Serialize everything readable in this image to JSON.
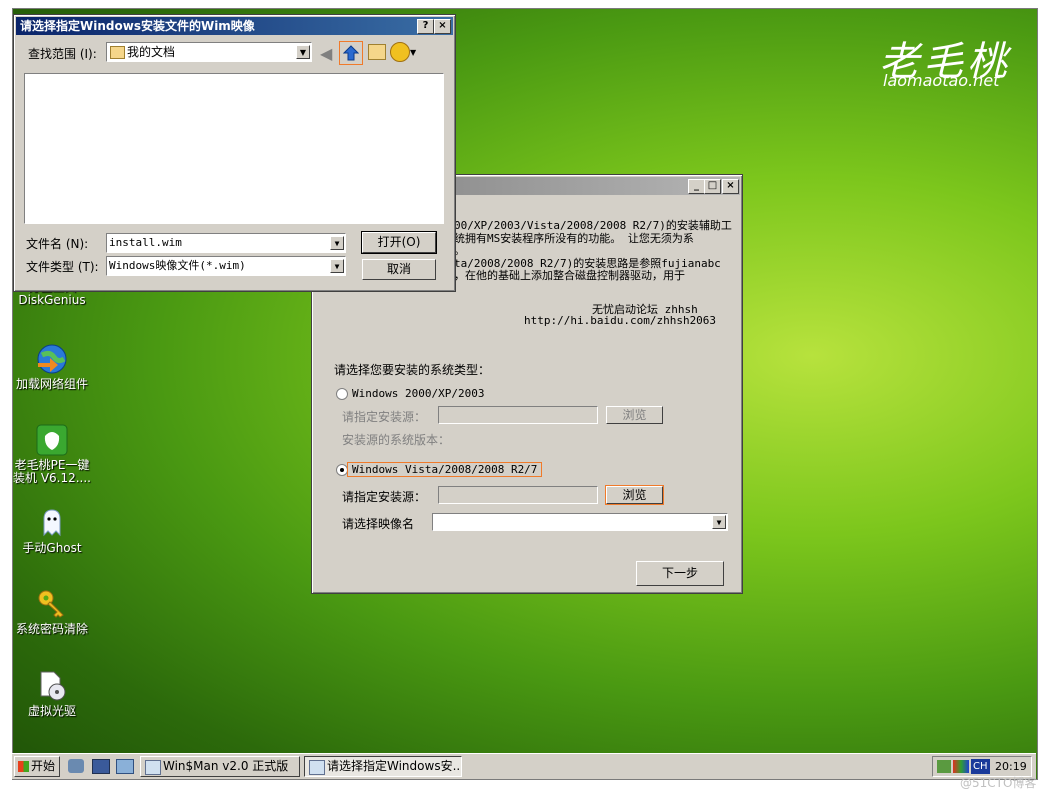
{
  "brand": {
    "logo": "老毛桃",
    "url": "laomaotao.net"
  },
  "desktop_icons": [
    {
      "label": "分区工具\nDiskGenius",
      "icon": "disk-icon"
    },
    {
      "label": "加载网络组件",
      "icon": "globe-icon"
    },
    {
      "label": "老毛桃PE一键装机 V6.12....",
      "icon": "installer-icon"
    },
    {
      "label": "手动Ghost",
      "icon": "ghost-icon"
    },
    {
      "label": "系统密码清除",
      "icon": "key-icon"
    },
    {
      "label": "虚拟光驱",
      "icon": "cdrom-icon"
    }
  ],
  "file_dialog": {
    "title": "请选择指定Windows安装文件的Wim映像",
    "help": "?",
    "close": "×",
    "look_in_label": "查找范围 (I):",
    "look_in_value": "我的文档",
    "filename_label": "文件名 (N):",
    "filename_value": "install.wim",
    "filetype_label": "文件类型 (T):",
    "filetype_value": "Windows映像文件(*.wim)",
    "open_button": "打开(O)",
    "cancel_button": "取消"
  },
  "main_window": {
    "minimize": "_",
    "maximize": "□",
    "close": "×",
    "desc_line1": "00/XP/2003/Vista/2008/2008 R2/7)的安装辅助工",
    "desc_line2": "统拥有MS安装程序所没有的功能。 让您无须为系",
    "desc_line3": "。",
    "desc_line4": "ta/2008/2008 R2/7)的安装思路是参照fujianabc",
    "desc_line5": "，在他的基础上添加整合磁盘控制器驱动，用于",
    "author": "无忧启动论坛 zhhsh",
    "link": "http://hi.baidu.com/zhhsh2063",
    "select_type_label": "请选择您要安装的系统类型：",
    "option_xp": "Windows 2000/XP/2003",
    "source_label_1": "请指定安装源：",
    "browse_1": "浏览",
    "version_label": "安装源的系统版本：",
    "option_vista": "Windows Vista/2008/2008 R2/7",
    "source_label_2": "请指定安装源：",
    "browse_2": "浏览",
    "image_label": "请选择映像名",
    "next_button": "下一步"
  },
  "taskbar": {
    "start": "开始",
    "tasks": [
      "Win$Man v2.0 正式版",
      "请选择指定Windows安..."
    ],
    "ime": "CH",
    "clock": "20:19"
  },
  "watermark": "@51CTO博客",
  "colors": {
    "titlebar": "#0a246a",
    "highlight": "#f07a2a",
    "desktop": "#5aa814"
  }
}
